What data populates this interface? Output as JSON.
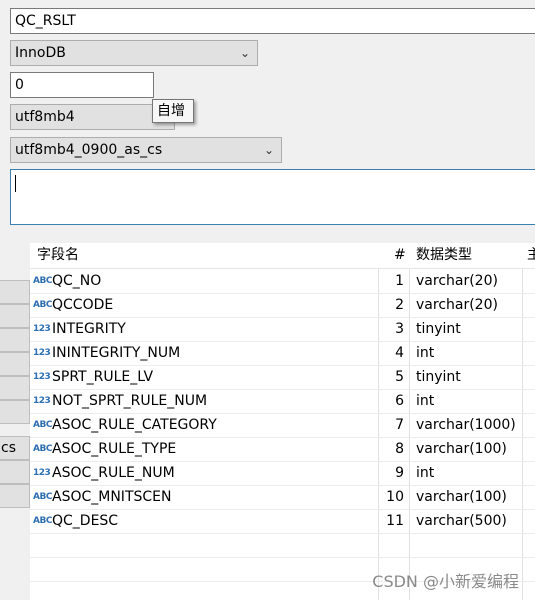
{
  "form": {
    "table_name": "QC_RSLT",
    "engine": "InnoDB",
    "auto_increment": "0",
    "charset": "utf8mb4",
    "collation": "utf8mb4_0900_as_cs",
    "comment": "",
    "tooltip": "自增"
  },
  "left_panel": {
    "partial_label": "cs"
  },
  "grid": {
    "headers": {
      "name": "字段名",
      "num": "#",
      "type": "数据类型",
      "extra": "主"
    },
    "rows": [
      {
        "icon": "ABC",
        "name": "QC_NO",
        "num": "1",
        "type": "varchar(20)"
      },
      {
        "icon": "ABC",
        "name": "QCCODE",
        "num": "2",
        "type": "varchar(20)"
      },
      {
        "icon": "123",
        "name": "INTEGRITY",
        "num": "3",
        "type": "tinyint"
      },
      {
        "icon": "123",
        "name": "ININTEGRITY_NUM",
        "num": "4",
        "type": "int"
      },
      {
        "icon": "123",
        "name": "SPRT_RULE_LV",
        "num": "5",
        "type": "tinyint"
      },
      {
        "icon": "123",
        "name": "NOT_SPRT_RULE_NUM",
        "num": "6",
        "type": "int"
      },
      {
        "icon": "ABC",
        "name": "ASOC_RULE_CATEGORY",
        "num": "7",
        "type": "varchar(1000)"
      },
      {
        "icon": "ABC",
        "name": "ASOC_RULE_TYPE",
        "num": "8",
        "type": "varchar(100)"
      },
      {
        "icon": "123",
        "name": "ASOC_RULE_NUM",
        "num": "9",
        "type": "int"
      },
      {
        "icon": "ABC",
        "name": "ASOC_MNITSCEN",
        "num": "10",
        "type": "varchar(100)"
      },
      {
        "icon": "ABC",
        "name": "QC_DESC",
        "num": "11",
        "type": "varchar(500)"
      }
    ]
  },
  "watermark": "CSDN @小新爱编程"
}
